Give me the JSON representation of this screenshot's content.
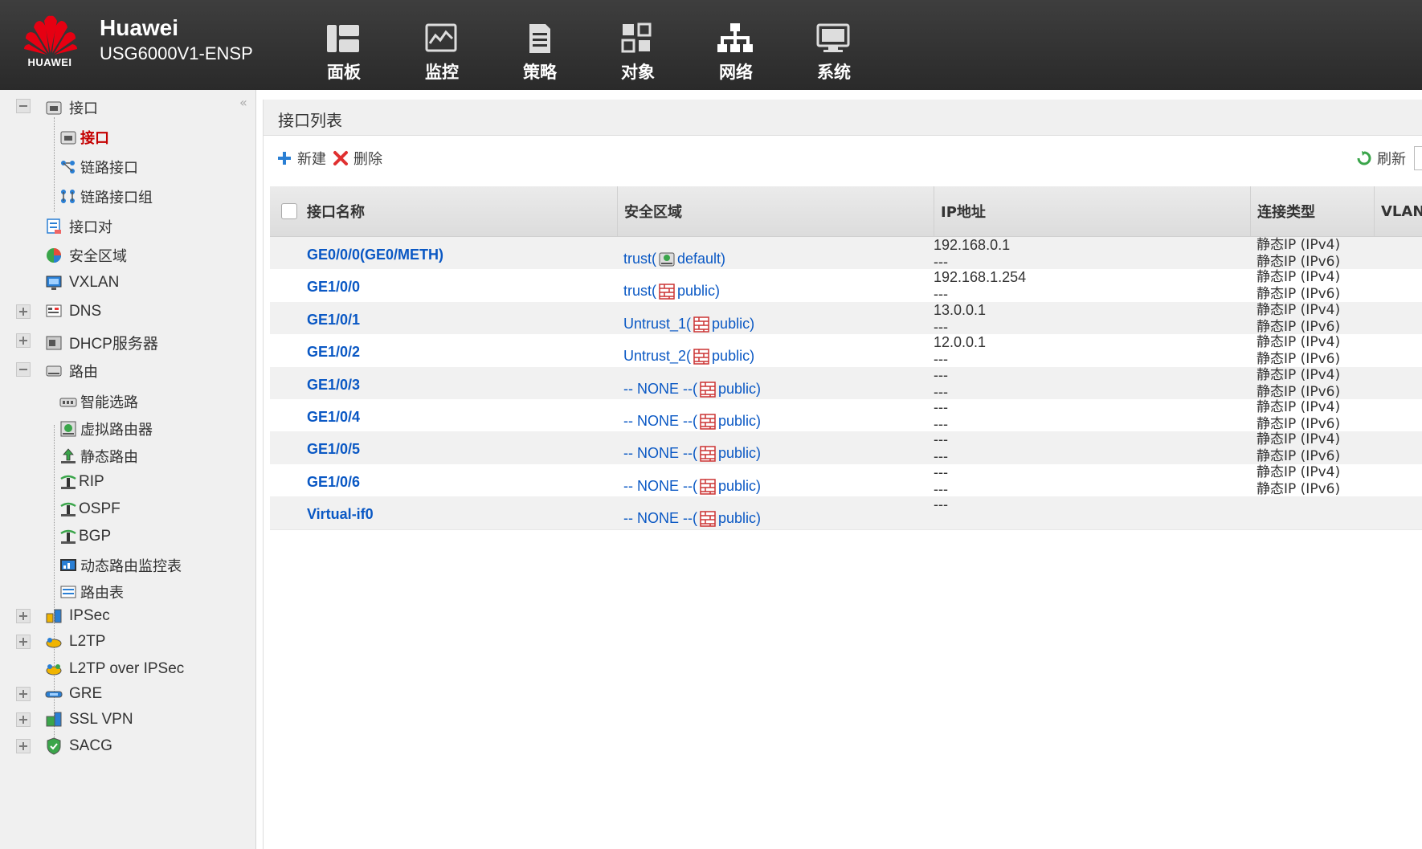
{
  "header": {
    "brand": "HUAWEI",
    "vendor": "Huawei",
    "model": "USG6000V1-ENSP",
    "nav": [
      {
        "label": "面板",
        "icon": "dashboard-icon"
      },
      {
        "label": "监控",
        "icon": "monitor-chart-icon"
      },
      {
        "label": "策略",
        "icon": "policy-document-icon"
      },
      {
        "label": "对象",
        "icon": "object-icon"
      },
      {
        "label": "网络",
        "icon": "network-topology-icon",
        "active": true
      },
      {
        "label": "系统",
        "icon": "system-monitor-icon"
      }
    ]
  },
  "sidebar": {
    "items": [
      {
        "label": "接口",
        "expander": "minus",
        "icon": "interface-icon"
      },
      {
        "label": "接口",
        "selected": true,
        "icon": "interface-icon"
      },
      {
        "label": "链路接口",
        "icon": "link-interface-icon"
      },
      {
        "label": "链路接口组",
        "icon": "link-interface-group-icon"
      },
      {
        "label": "接口对",
        "icon": "interface-pair-icon"
      },
      {
        "label": "安全区域",
        "icon": "security-zone-icon"
      },
      {
        "label": "VXLAN",
        "icon": "vxlan-icon"
      },
      {
        "label": "DNS",
        "expander": "plus",
        "icon": "dns-icon"
      },
      {
        "label": "DHCP服务器",
        "expander": "plus",
        "icon": "dhcp-server-icon"
      },
      {
        "label": "路由",
        "expander": "minus",
        "icon": "router-icon"
      },
      {
        "label": "智能选路",
        "icon": "smart-routing-icon"
      },
      {
        "label": "虚拟路由器",
        "icon": "virtual-router-icon"
      },
      {
        "label": "静态路由",
        "icon": "static-route-icon"
      },
      {
        "label": "RIP",
        "icon": "rip-icon"
      },
      {
        "label": "OSPF",
        "icon": "ospf-icon"
      },
      {
        "label": "BGP",
        "icon": "bgp-icon"
      },
      {
        "label": "动态路由监控表",
        "icon": "dynamic-route-monitor-icon"
      },
      {
        "label": "路由表",
        "icon": "route-table-icon"
      },
      {
        "label": "IPSec",
        "expander": "plus",
        "icon": "ipsec-icon"
      },
      {
        "label": "L2TP",
        "expander": "plus",
        "icon": "l2tp-icon"
      },
      {
        "label": "L2TP over IPSec",
        "icon": "l2tp-over-ipsec-icon"
      },
      {
        "label": "GRE",
        "expander": "plus",
        "icon": "gre-icon"
      },
      {
        "label": "SSL VPN",
        "expander": "plus",
        "icon": "ssl-vpn-icon"
      },
      {
        "label": "SACG",
        "expander": "plus",
        "icon": "sacg-shield-icon"
      }
    ]
  },
  "main": {
    "title": "接口列表",
    "toolbar": {
      "new_label": "新建",
      "delete_label": "删除",
      "refresh_label": "刷新"
    },
    "columns": [
      "接口名称",
      "安全区域",
      "IP地址",
      "连接类型",
      "VLAN"
    ],
    "rows": [
      {
        "name": "GE0/0/0(GE0/METH)",
        "zone": "trust(",
        "zone_tail": "default)",
        "vs_icon": "vsys-default-icon",
        "ip1": "192.168.0.1",
        "ip2": "---",
        "conn1": "静态IP (IPv4)",
        "conn2": "静态IP (IPv6)"
      },
      {
        "name": "GE1/0/0",
        "zone": "trust(",
        "zone_tail": "public)",
        "vs_icon": "vsys-public-icon",
        "ip1": "192.168.1.254",
        "ip2": "---",
        "conn1": "静态IP (IPv4)",
        "conn2": "静态IP (IPv6)"
      },
      {
        "name": "GE1/0/1",
        "zone": "Untrust_1(",
        "zone_tail": "public)",
        "vs_icon": "vsys-public-icon",
        "ip1": "13.0.0.1",
        "ip2": "---",
        "conn1": "静态IP (IPv4)",
        "conn2": "静态IP (IPv6)"
      },
      {
        "name": "GE1/0/2",
        "zone": "Untrust_2(",
        "zone_tail": "public)",
        "vs_icon": "vsys-public-icon",
        "ip1": "12.0.0.1",
        "ip2": "---",
        "conn1": "静态IP (IPv4)",
        "conn2": "静态IP (IPv6)"
      },
      {
        "name": "GE1/0/3",
        "zone": "-- NONE --(",
        "zone_tail": "public)",
        "vs_icon": "vsys-public-icon",
        "ip1": "---",
        "ip2": "---",
        "conn1": "静态IP (IPv4)",
        "conn2": "静态IP (IPv6)"
      },
      {
        "name": "GE1/0/4",
        "zone": "-- NONE --(",
        "zone_tail": "public)",
        "vs_icon": "vsys-public-icon",
        "ip1": "---",
        "ip2": "---",
        "conn1": "静态IP (IPv4)",
        "conn2": "静态IP (IPv6)"
      },
      {
        "name": "GE1/0/5",
        "zone": "-- NONE --(",
        "zone_tail": "public)",
        "vs_icon": "vsys-public-icon",
        "ip1": "---",
        "ip2": "---",
        "conn1": "静态IP (IPv4)",
        "conn2": "静态IP (IPv6)"
      },
      {
        "name": "GE1/0/6",
        "zone": "-- NONE --(",
        "zone_tail": "public)",
        "vs_icon": "vsys-public-icon",
        "ip1": "---",
        "ip2": "---",
        "conn1": "静态IP (IPv4)",
        "conn2": "静态IP (IPv6)"
      },
      {
        "name": "Virtual-if0",
        "zone": "-- NONE --(",
        "zone_tail": "public)",
        "vs_icon": "vsys-public-icon",
        "ip1": "---",
        "ip2": "",
        "conn1": "",
        "conn2": ""
      }
    ]
  },
  "colors": {
    "link": "#0a58c4",
    "selected": "#c40000",
    "header_bg": "#333333",
    "brand_red": "#e60012"
  }
}
